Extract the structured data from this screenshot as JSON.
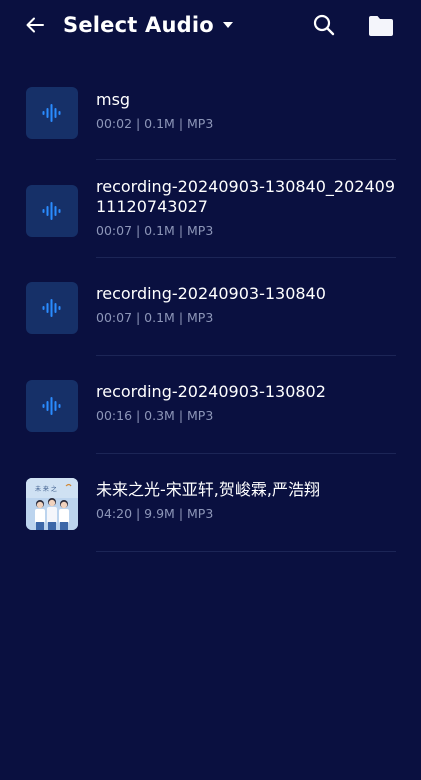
{
  "header": {
    "title": "Select Audio",
    "back_icon": "arrow-left-icon",
    "caret_icon": "caret-down-icon",
    "search_icon": "search-icon",
    "folder_icon": "folder-icon"
  },
  "colors": {
    "background": "#0a1040",
    "thumb_bg": "#163068",
    "accent": "#2a8cff",
    "meta_text": "#8d96b8"
  },
  "files": [
    {
      "name": "msg",
      "meta": "00:02 | 0.1M | MP3",
      "thumb": "audio-wave-icon"
    },
    {
      "name": "recording-20240903-130840_20240911120743027",
      "meta": "00:07 | 0.1M | MP3",
      "thumb": "audio-wave-icon"
    },
    {
      "name": "recording-20240903-130840",
      "meta": "00:07 | 0.1M | MP3",
      "thumb": "audio-wave-icon"
    },
    {
      "name": "recording-20240903-130802",
      "meta": "00:16 | 0.3M | MP3",
      "thumb": "audio-wave-icon"
    },
    {
      "name": "未来之光-宋亚轩,贺峻霖,严浩翔",
      "meta": "04:20 | 9.9M | MP3",
      "thumb": "album-art"
    }
  ]
}
